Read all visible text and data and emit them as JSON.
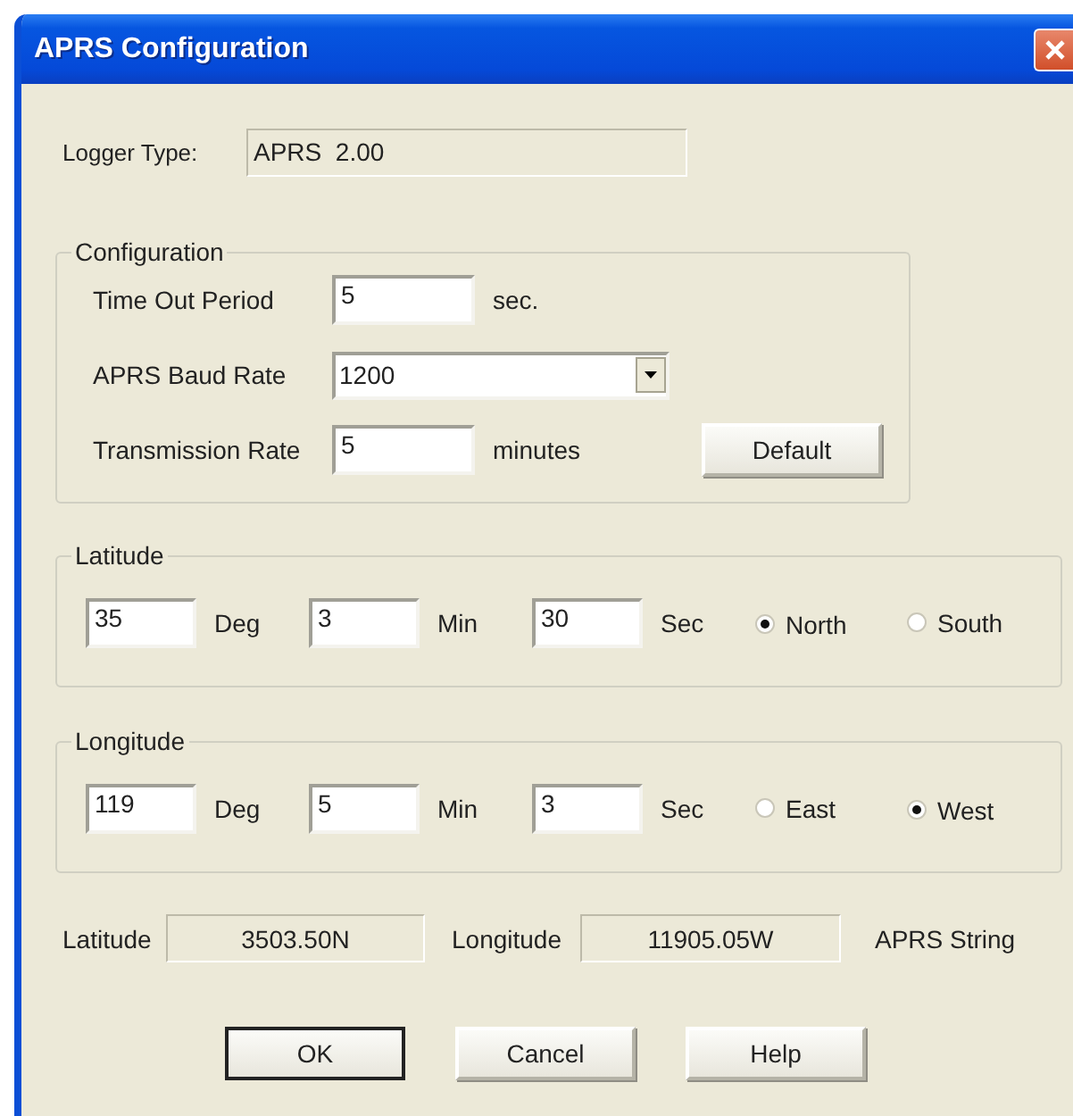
{
  "window": {
    "title": "APRS Configuration"
  },
  "logger_type": {
    "label": "Logger Type:",
    "value": "APRS  2.00"
  },
  "configuration": {
    "title": "Configuration",
    "rows": [
      {
        "kind": "text",
        "label": "Time Out Period",
        "value": "5",
        "unit": "sec."
      },
      {
        "kind": "dropdown",
        "label": "APRS Baud Rate",
        "value": "1200"
      },
      {
        "kind": "text",
        "label": "Transmission Rate",
        "value": "5",
        "unit": "minutes"
      }
    ],
    "default_button": "Default"
  },
  "latitude": {
    "title": "Latitude",
    "fields": [
      {
        "value": "35",
        "unit": "Deg"
      },
      {
        "value": "3",
        "unit": "Min"
      },
      {
        "value": "30",
        "unit": "Sec"
      }
    ],
    "options": [
      {
        "label": "North",
        "selected": true
      },
      {
        "label": "South",
        "selected": false
      }
    ]
  },
  "longitude": {
    "title": "Longitude",
    "fields": [
      {
        "value": "119",
        "unit": "Deg"
      },
      {
        "value": "5",
        "unit": "Min"
      },
      {
        "value": "3",
        "unit": "Sec"
      }
    ],
    "options": [
      {
        "label": "East",
        "selected": false
      },
      {
        "label": "West",
        "selected": true
      }
    ]
  },
  "summary": [
    {
      "label": "Latitude",
      "value": "3503.50N"
    },
    {
      "label": "Longitude",
      "value": "11905.05W"
    }
  ],
  "aprs_string_label": "APRS String",
  "buttons": [
    {
      "label": "OK",
      "default": true
    },
    {
      "label": "Cancel",
      "default": false
    },
    {
      "label": "Help",
      "default": false
    }
  ]
}
